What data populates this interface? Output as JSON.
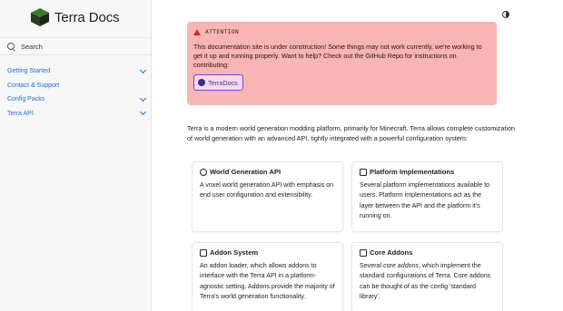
{
  "sidebar": {
    "brand": {
      "title": "Terra Docs",
      "logo": "terra-cube-logo"
    },
    "search": {
      "label": "Search",
      "icon": "search-icon"
    },
    "items": [
      {
        "label": "Getting Started",
        "expandable": true
      },
      {
        "label": "Contact & Support",
        "expandable": false
      },
      {
        "label": "Config Packs",
        "expandable": true
      },
      {
        "label": "Terra API",
        "expandable": true
      }
    ]
  },
  "header": {
    "theme_toggle_icon": "contrast-icon"
  },
  "callout": {
    "heading": "ATTENTION",
    "icon": "warning-icon",
    "text": "This documentation site is under construction! Some things may not work currently, we're working to get it up and running properly. Want to help? Check out the GitHub Repo for instructions on contributing:",
    "button_label": "TerraDocs",
    "button_icon": "github-icon",
    "bg_color": "#f9b4b4"
  },
  "intro": "Terra is a modern world generation modding platform, primarily for Minecraft. Terra allows complete customization of world generation with an advanced API, tightly integrated with a powerful configuration system:",
  "cards": [
    {
      "title": "World Generation API",
      "icon": "globe-icon",
      "text": "A voxel world generation API with emphasis on end user configuration and extensibility."
    },
    {
      "title": "Platform Implementations",
      "icon": "platform-icon",
      "text": "Several platform implementations available to users. Platform implementations act as the layer between the API and the platform it's running on."
    },
    {
      "title": "Addon System",
      "icon": "puzzle-icon",
      "text": "An addon loader, which allows addons to interface with the Terra API in a platform-agnostic setting. Addons provide the majority of Terra's world generation functionality."
    },
    {
      "title": "Core Addons",
      "icon": "addons-icon",
      "text_prefix": "Several ",
      "text_em": "core addons",
      "text_suffix": ", which implement the standard configurations of Terra. Core addons can be thought of as the config 'standard library'."
    }
  ],
  "accent_color": "#1a6fd6"
}
